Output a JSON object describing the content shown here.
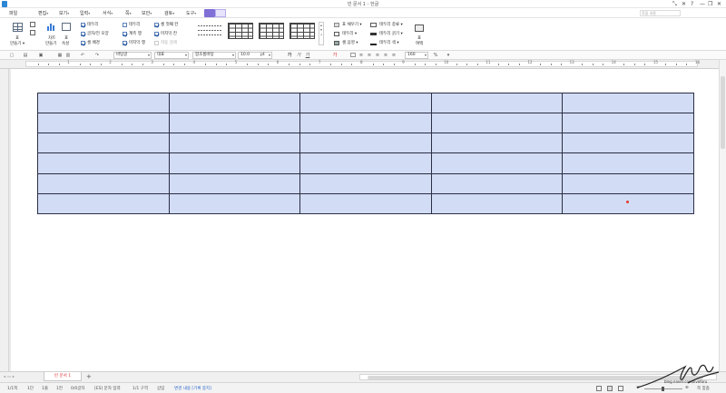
{
  "window": {
    "title": "빈 문서 1 - 한글",
    "controls": [
      "⤡",
      "✕",
      "?",
      "—",
      "❐",
      "✕"
    ]
  },
  "menubar": {
    "items": [
      {
        "label": "파일"
      },
      {
        "label": "편집",
        "caret": "▾"
      },
      {
        "label": "보기",
        "caret": "▾"
      },
      {
        "label": "입력",
        "caret": "▾"
      },
      {
        "label": "서식",
        "caret": "▾"
      },
      {
        "label": "쪽",
        "caret": "▾"
      },
      {
        "label": "보안",
        "caret": "▾"
      },
      {
        "label": "검토",
        "caret": "▾"
      },
      {
        "label": "도구",
        "caret": "▾"
      }
    ],
    "help_placeholder": "찾을 내용"
  },
  "ribbon": {
    "table_button": {
      "line1": "표",
      "line2": "만들기 ▾"
    },
    "chart_button": {
      "line1": "차트",
      "line2": "만들기"
    },
    "props_button": {
      "line1": "표",
      "line2": "속성"
    },
    "checks": [
      {
        "label": "제목 행",
        "checked": true
      },
      {
        "label": "첫째 열",
        "checked": false
      },
      {
        "label": "줄무늬 행",
        "checked": true
      },
      {
        "label": "마지막 열",
        "checked": false
      },
      {
        "label": "마지막 행",
        "checked": false
      },
      {
        "label": "줄무늬 열",
        "checked": true
      }
    ],
    "checks2": [
      {
        "label": "테두리",
        "checked": true
      },
      {
        "label": "글자/전 모양",
        "checked": true
      },
      {
        "label": "셀 배경",
        "checked": true
      },
      {
        "label": "테두리",
        "checked": false
      },
      {
        "label": "셀 배경",
        "checked": true
      },
      {
        "label": "마지막 행",
        "checked": true
      }
    ],
    "checks3": [
      {
        "label": "테두리"
      },
      {
        "label": "계측 행"
      },
      {
        "label": "마지막 행"
      },
      {
        "label": "셀 첫째 칸"
      },
      {
        "label": "마지막 칸"
      },
      {
        "label": "자동 검색"
      }
    ],
    "right_labels": [
      "표 채우기 ▾",
      "테두리 ▾",
      "셀 음영 ▾",
      "테두리 종류 ▾",
      "테두리 굵기 ▾",
      "테두리 색 ▾"
    ],
    "margin_button": {
      "line1": "표",
      "line2": "여백"
    }
  },
  "toolbar": {
    "style": "바탕글",
    "lang": "대표",
    "font": "함초롬바탕",
    "size": "10.0",
    "size_unit": "pt",
    "zoom": "160",
    "zoom_unit": "%"
  },
  "ruler": {
    "numbers": [
      "1",
      "2",
      "3",
      "4",
      "5",
      "6",
      "7",
      "8",
      "9",
      "10",
      "11",
      "12",
      "13",
      "14",
      "15",
      "16"
    ]
  },
  "table": {
    "rows": 6,
    "cols": 5,
    "fill": "#d2dcf4",
    "border": "#2a2f45"
  },
  "tabbar": {
    "tab_label": "빈 문서 1",
    "add": "+"
  },
  "statusbar": {
    "items": [
      "1/1쪽",
      "1단",
      "1줄",
      "1칸",
      "0/0글자",
      "[ES] 문자 입력",
      "1/1 구역",
      "삽입",
      "변경 내용 [기록 중지]"
    ],
    "zoom": "쪽 맞춤"
  },
  "watermark": {
    "url": "blog.naver.com/liveforu"
  }
}
